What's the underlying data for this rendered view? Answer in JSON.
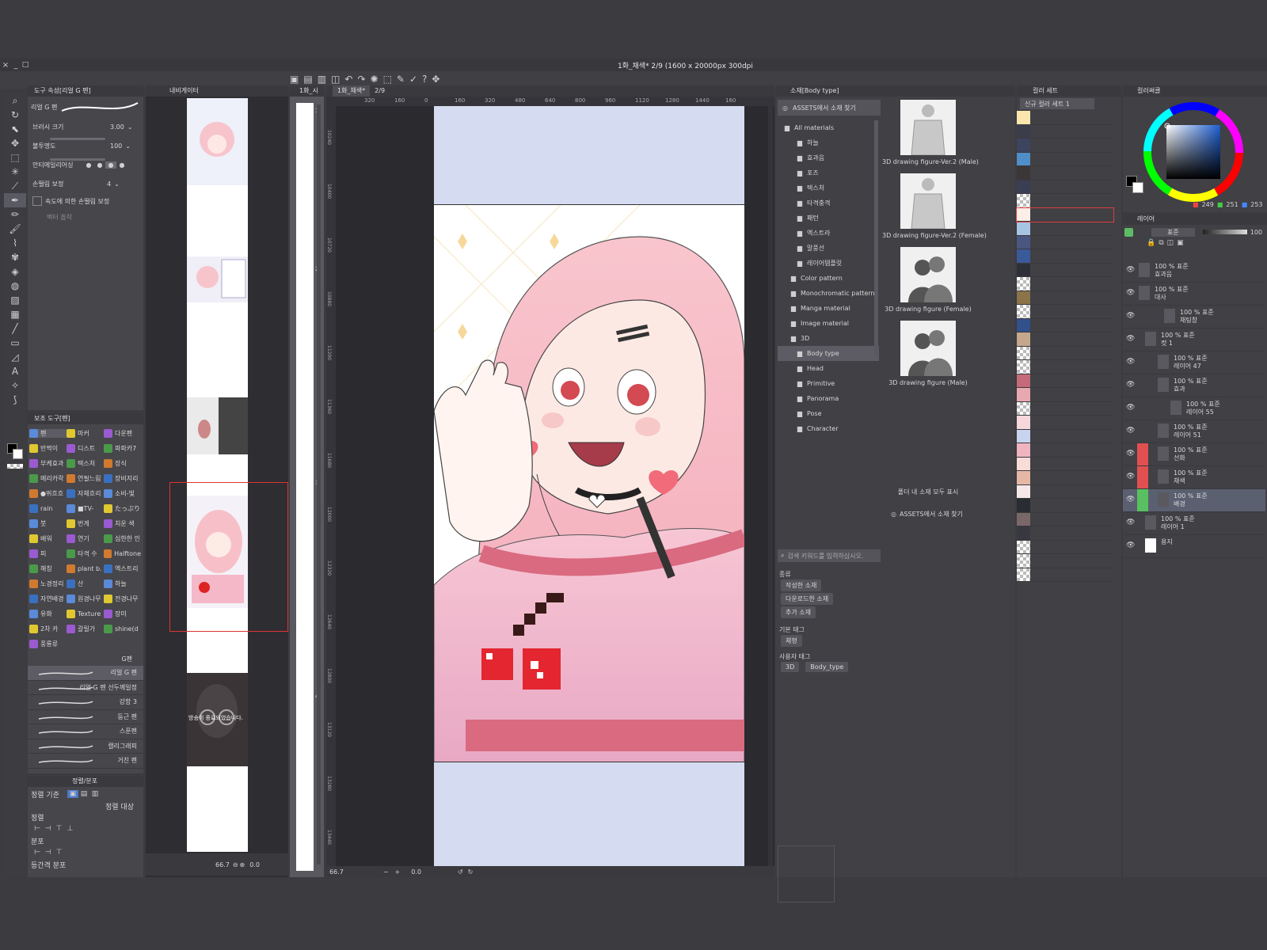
{
  "window": {
    "title": "1화_채색* 2/9 (1600 x 20000px 300dpi"
  },
  "tool_property": {
    "header": "도구 속성[리얼 G 펜]",
    "tool_name": "리얼 G 펜",
    "brush_size_label": "브러시 크기",
    "brush_size_value": "3.00",
    "opacity_label": "불투명도",
    "opacity_value": "100",
    "antialias_label": "안티에일리어싱",
    "stabilization_label": "손떨림 보정",
    "stabilization_value": "4",
    "speed_stabilization_label": "속도에 의한 손떨림 보정",
    "vector_label": "벡터 흡착"
  },
  "sub_tool": {
    "header": "보조 도구[펜]",
    "grid": [
      [
        "펜",
        "마커",
        "다운펜"
      ],
      [
        "반짝이",
        "디스트",
        "파파카7"
      ],
      [
        "부케효과",
        "텍스처",
        "장식"
      ],
      [
        "메리카락",
        "연필느림",
        "장비지리"
      ],
      [
        "●뛰흐흐",
        "자체흐리",
        "소비-빛"
      ],
      [
        "rain",
        "■TV-",
        "たっぷり"
      ],
      [
        "붓",
        "번게",
        "치운 색"
      ],
      [
        "배워",
        "연기",
        "심한한 인"
      ],
      [
        "피",
        "타격 수",
        "Halftone"
      ],
      [
        "해칭",
        "plant b.",
        "엑스트리"
      ],
      [
        "노경정리",
        "산",
        "하늘"
      ],
      [
        "자연배경",
        "원경나무",
        "전경나무"
      ],
      [
        "유화",
        "Texture",
        "장미"
      ],
      [
        "2차 카",
        "갈릴가",
        "shine(d"
      ],
      [
        "풍룡류"
      ]
    ],
    "group_label": "G펜",
    "brushes": [
      "리얼 G 펜",
      "리얼 G 펜 선두께일정",
      "강함 3",
      "둥근 펜",
      "스푼펜",
      "캘리그래피",
      "거친 펜"
    ]
  },
  "align_panel": {
    "header": "정렬/분포",
    "align_basis_label": "정렬 기준",
    "align_target_label": "정렬 대상",
    "align_label": "정렬",
    "distribute_label": "분포",
    "equal_spacing_label": "등간격 분포"
  },
  "navigator": {
    "header": "내비게이터",
    "thumb_text": "방송이 종료되었습니다.",
    "zoom": "66.7",
    "rotation": "0.0"
  },
  "page_strip": {
    "tab": "1화_시",
    "page_numbers": [
      "1",
      "2",
      "3",
      "4"
    ]
  },
  "canvas": {
    "tab": "1화_채색*",
    "page": "2/9",
    "ruler_labels": [
      "320",
      "160",
      "0",
      "160",
      "320",
      "480",
      "640",
      "800",
      "960",
      "1120",
      "1280",
      "1440",
      "160"
    ],
    "v_ruler_labels": [
      "10240",
      "10400",
      "10720",
      "10880",
      "11200",
      "11360",
      "11680",
      "12000",
      "12320",
      "12640",
      "12800",
      "13120",
      "13280",
      "13440"
    ],
    "zoom": "66.7",
    "rotation": "0.0"
  },
  "materials": {
    "header": "소재[Body type]",
    "assets_button": "ASSETS에서 소재 찾기",
    "tree": [
      "All materials",
      "하늘",
      "효과음",
      "포즈",
      "텍스처",
      "타격충격",
      "패턴",
      "엑스트라",
      "말풍선",
      "레이어템플릿",
      "Color pattern",
      "Monochromatic pattern",
      "Manga material",
      "Image material",
      "3D",
      "Body type",
      "Head",
      "Primitive",
      "Panorama",
      "Pose",
      "Character"
    ],
    "items": [
      "3D drawing figure-Ver.2 (Male)",
      "3D drawing figure-Ver.2 (Female)",
      "3D drawing figure (Female)",
      "3D drawing figure (Male)"
    ],
    "show_all_label": "폴더 내 소재 모두 표시",
    "assets_link": "ASSETS에서 소재 찾기",
    "search_placeholder": "검색 키워드를 입력하십시오.",
    "kind_label": "종류",
    "kind_tags": [
      "작성한 소재",
      "다운로드한 소재",
      "추가 소재"
    ],
    "basic_tag_label": "기본 태그",
    "basic_tags": [
      "체형"
    ],
    "user_tag_label": "사용자 태그",
    "user_tags": [
      "3D",
      "Body_type"
    ]
  },
  "color_set": {
    "header": "컬러 세트",
    "set_name": "신규 컬러 세트 1",
    "swatches": [
      "#fbe6b0",
      "#3b3e4a",
      "#3c4460",
      "#4f8ec7",
      "#3b3638",
      "#3a3e55",
      "checker",
      "#fbeee6",
      "#a8c4e4",
      "#4b5680",
      "#3b5a99",
      "#2e3038",
      "checker",
      "#8a7448",
      "checker",
      "#32508a",
      "#c4a78c",
      "checker",
      "checker",
      "#c46a78",
      "#e8a8b0",
      "checker",
      "#f6d8dc",
      "#c8d4ef",
      "#f0b4c0",
      "#f8dcd8",
      "#e4b8a4",
      "#f4e8e8",
      "#2a2c34",
      "#7a6868",
      "#383840",
      "checker",
      "checker",
      "checker"
    ]
  },
  "color_wheel": {
    "header": "컬러써클",
    "header2": "",
    "r": "249",
    "g": "251",
    "b": "253",
    "accent": "#f9fbfd"
  },
  "layers": {
    "header": "레이어",
    "blend_mode": "표준",
    "opacity": "100",
    "rows": [
      {
        "line1": "100 % 표준",
        "line2": "효과음"
      },
      {
        "line1": "100 % 표준",
        "line2": "대사"
      },
      {
        "line1": "100 % 표준",
        "line2": "채팅창"
      },
      {
        "line1": "100 % 표준",
        "line2": "컷 1"
      },
      {
        "line1": "100 % 표준",
        "line2": "레이어 47"
      },
      {
        "line1": "100 % 표준",
        "line2": "효과"
      },
      {
        "line1": "100 % 표준",
        "line2": "레이어 55"
      },
      {
        "line1": "100 % 표준",
        "line2": "레이어 51"
      },
      {
        "line1": "100 % 표준",
        "line2": "선화"
      },
      {
        "line1": "100 % 표준",
        "line2": "채색"
      },
      {
        "line1": "100 % 표준",
        "line2": "배경"
      },
      {
        "line1": "100 % 표준",
        "line2": "레이어 1"
      },
      {
        "line1": "",
        "line2": "용지"
      }
    ]
  }
}
